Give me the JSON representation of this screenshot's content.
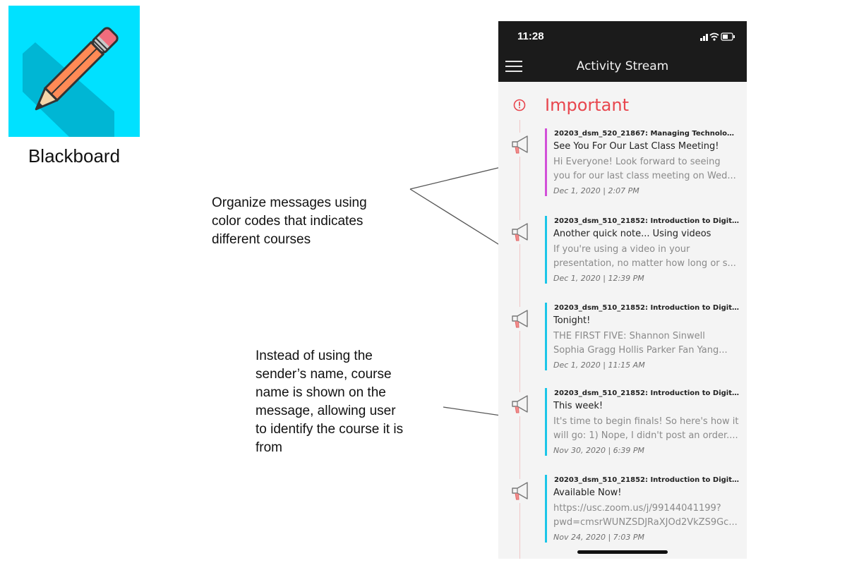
{
  "app": {
    "name": "Blackboard",
    "icon": "pencil-icon",
    "icon_bg": "#00e1ff"
  },
  "annotations": [
    {
      "lines": [
        "Organize messages using",
        "color codes that indicates",
        "different courses"
      ]
    },
    {
      "lines": [
        "Instead of using the",
        "sender’s name, course",
        "name is shown on the",
        "message, allowing user",
        "to identify the course it is",
        "from"
      ]
    }
  ],
  "phone": {
    "status": {
      "time": "11:28",
      "icons": [
        "signal-icon",
        "wifi-icon",
        "battery-icon"
      ]
    },
    "header": {
      "title": "Activity Stream",
      "menu_icon": "hamburger-menu-icon"
    },
    "section": {
      "label": "Important",
      "icon": "alert-circle-icon",
      "color": "#e8464e"
    },
    "items": [
      {
        "course": "20203_dsm_520_21867: Managing Technologie...",
        "title": "See You For Our Last Class Meeting!",
        "preview": [
          "Hi Everyone!  Look forward to seeing",
          "you for our last class meeting on Wed..."
        ],
        "date": "Dec 1, 2020 | 2:07 PM",
        "color": "#d24fd8"
      },
      {
        "course": "20203_dsm_510_21852: Introduction to Digital...",
        "title": "Another quick note... Using videos",
        "preview": [
          "If you're using a video in your",
          "presentation, no matter how long or s..."
        ],
        "date": "Dec 1, 2020 | 12:39 PM",
        "color": "#1bc6e8"
      },
      {
        "course": "20203_dsm_510_21852: Introduction to Digital...",
        "title": "Tonight!",
        "preview": [
          "THE FIRST FIVE:   Shannon Sinwell",
          "Sophia Gragg  Hollis Parker  Fan Yang..."
        ],
        "date": "Dec 1, 2020 | 11:15 AM",
        "color": "#1bc6e8"
      },
      {
        "course": "20203_dsm_510_21852: Introduction to Digital...",
        "title": "This week!",
        "preview": [
          "It's time to begin finals!  So here's how it",
          "will go:  1) Nope, I didn't post an order...."
        ],
        "date": "Nov 30, 2020 | 6:39 PM",
        "color": "#1bc6e8"
      },
      {
        "course": "20203_dsm_510_21852: Introduction to Digital...",
        "title": "Available Now!",
        "preview": [
          "https://usc.zoom.us/j/99144041199?",
          "pwd=cmsrWUNZSDJRaXJOd2VkZS9Gc..."
        ],
        "date": "Nov 24, 2020 | 7:03 PM",
        "color": "#1bc6e8"
      }
    ]
  }
}
